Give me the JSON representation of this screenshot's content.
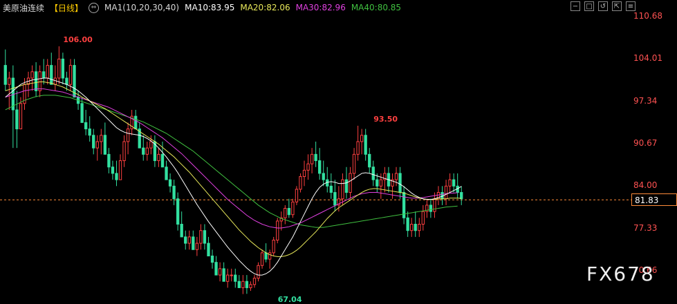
{
  "header": {
    "title": "美原油连续",
    "period": "【日线】",
    "settings_icon": "gear-icon",
    "switch_icon": "swap-icon",
    "ma_params": "MA1(10,20,30,40)",
    "ma10": "MA10:83.95",
    "ma20": "MA20:82.06",
    "ma30": "MA30:82.96",
    "ma40": "MA40:80.85"
  },
  "toolbar": {
    "buttons": [
      "−",
      "□",
      "↺",
      "⇱",
      "≡"
    ]
  },
  "watermark": "FX678",
  "colors": {
    "up": "#ff4040",
    "down": "#32e0a0",
    "ma10": "#ffffff",
    "ma20": "#e8e85a",
    "ma30": "#e040e0",
    "ma40": "#40c040",
    "axis_text": "#ff5252",
    "current_price_line": "#ff8c3a"
  },
  "chart_data": {
    "type": "candlestick",
    "y_ticks": [
      "110.68",
      "104.01",
      "97.34",
      "90.67",
      "84.00",
      "77.33",
      "70.66"
    ],
    "ylim": [
      67.04,
      110.68
    ],
    "current_price": "81.83",
    "annotations": [
      {
        "label": "106.00",
        "value": 106.0,
        "index": 14
      },
      {
        "label": "93.50",
        "value": 93.5,
        "index": 95
      },
      {
        "label": "67.04",
        "value": 67.04,
        "index": 70
      }
    ],
    "candles": [
      [
        103,
        105.5,
        99,
        100
      ],
      [
        100,
        102,
        96,
        101
      ],
      [
        101,
        103,
        90,
        96
      ],
      [
        96,
        99,
        90,
        93
      ],
      [
        93,
        98,
        93,
        97
      ],
      [
        97,
        101,
        96,
        100
      ],
      [
        100,
        102,
        98,
        101
      ],
      [
        101,
        103,
        99,
        102
      ],
      [
        102,
        103.5,
        98,
        99
      ],
      [
        99,
        103,
        98,
        102
      ],
      [
        102,
        104,
        100,
        101
      ],
      [
        101,
        104,
        100,
        103
      ],
      [
        103,
        105,
        100,
        100
      ],
      [
        100,
        103,
        99,
        101
      ],
      [
        101,
        106,
        100,
        104
      ],
      [
        104,
        105,
        100,
        101
      ],
      [
        101,
        102,
        99,
        100
      ],
      [
        100,
        104,
        99,
        103
      ],
      [
        103,
        104,
        98,
        98
      ],
      [
        98,
        99,
        96,
        97
      ],
      [
        97,
        98,
        94,
        94
      ],
      [
        94,
        96,
        92,
        93
      ],
      [
        93,
        95,
        91,
        92
      ],
      [
        92,
        93,
        89,
        90
      ],
      [
        90,
        92,
        88,
        91
      ],
      [
        91,
        93,
        89,
        92
      ],
      [
        92,
        94,
        89,
        89
      ],
      [
        89,
        90,
        86,
        87
      ],
      [
        87,
        88,
        85,
        86
      ],
      [
        86,
        88,
        84,
        85
      ],
      [
        85,
        89,
        85,
        88
      ],
      [
        88,
        92,
        87,
        91
      ],
      [
        91,
        94,
        89,
        93
      ],
      [
        93,
        96,
        92,
        95
      ],
      [
        95,
        96,
        93,
        93
      ],
      [
        93,
        94,
        90,
        90
      ],
      [
        90,
        92,
        88,
        89
      ],
      [
        89,
        91,
        88,
        90
      ],
      [
        90,
        92,
        89,
        91
      ],
      [
        91,
        92,
        87,
        88
      ],
      [
        88,
        90,
        87,
        89
      ],
      [
        89,
        91,
        87,
        87
      ],
      [
        87,
        88,
        85,
        85
      ],
      [
        85,
        86,
        83,
        84
      ],
      [
        84,
        85,
        81,
        82
      ],
      [
        82,
        83,
        77,
        78
      ],
      [
        78,
        80,
        76,
        76
      ],
      [
        76,
        77,
        74,
        75
      ],
      [
        75,
        77,
        74,
        76
      ],
      [
        76,
        77,
        74,
        74
      ],
      [
        74,
        76,
        73,
        75
      ],
      [
        75,
        78,
        74,
        77
      ],
      [
        77,
        78,
        74,
        75
      ],
      [
        75,
        76,
        73,
        73
      ],
      [
        73,
        74,
        71,
        72
      ],
      [
        72,
        73,
        70,
        70
      ],
      [
        70,
        72,
        69,
        71
      ],
      [
        71,
        72,
        69,
        69
      ],
      [
        69,
        71,
        68,
        70
      ],
      [
        70,
        71,
        69,
        70
      ],
      [
        70,
        71,
        68,
        69
      ],
      [
        69,
        70,
        68,
        68
      ],
      [
        68,
        70,
        67,
        69
      ],
      [
        69,
        70,
        67.04,
        68
      ],
      [
        68,
        69,
        67.5,
        68.5
      ],
      [
        68.5,
        70,
        68,
        69.5
      ],
      [
        69.5,
        72,
        69,
        71.5
      ],
      [
        71.5,
        74,
        71,
        73.5
      ],
      [
        73.5,
        75,
        72,
        72.5
      ],
      [
        72.5,
        74,
        71,
        73.5
      ],
      [
        73.5,
        76,
        73,
        75.5
      ],
      [
        75.5,
        79,
        75,
        78.5
      ],
      [
        78.5,
        80,
        77,
        79
      ],
      [
        79,
        81,
        78,
        80.5
      ],
      [
        80.5,
        82,
        79,
        79.5
      ],
      [
        79.5,
        82,
        79,
        81.5
      ],
      [
        81.5,
        84,
        81,
        83.5
      ],
      [
        83.5,
        86,
        83,
        85.5
      ],
      [
        85.5,
        88,
        84,
        86.5
      ],
      [
        86.5,
        89,
        85,
        87.5
      ],
      [
        87.5,
        90,
        86,
        89
      ],
      [
        89,
        91,
        87,
        88
      ],
      [
        88,
        90,
        85,
        86
      ],
      [
        86,
        88,
        84,
        85
      ],
      [
        85,
        87,
        83,
        84
      ],
      [
        84,
        86,
        82,
        83
      ],
      [
        83,
        85,
        80,
        81
      ],
      [
        81,
        84,
        80,
        82
      ],
      [
        82,
        86,
        81,
        85
      ],
      [
        85,
        87,
        82,
        83
      ],
      [
        83,
        87,
        82,
        86
      ],
      [
        86,
        90,
        85,
        89
      ],
      [
        89,
        93.5,
        88,
        91
      ],
      [
        91,
        93,
        89,
        92
      ],
      [
        92,
        93,
        88,
        89
      ],
      [
        89,
        90,
        86,
        87
      ],
      [
        87,
        88,
        84,
        85
      ],
      [
        85,
        86,
        83,
        84
      ],
      [
        84,
        86,
        82,
        85
      ],
      [
        85,
        87,
        83,
        86
      ],
      [
        86,
        87,
        83,
        84
      ],
      [
        84,
        86,
        82,
        85
      ],
      [
        85,
        87,
        84,
        86
      ],
      [
        86,
        87,
        82,
        83
      ],
      [
        83,
        84,
        78,
        79
      ],
      [
        79,
        80,
        76,
        77
      ],
      [
        77,
        79,
        76,
        78
      ],
      [
        78,
        80,
        76,
        77
      ],
      [
        77,
        79,
        76,
        78
      ],
      [
        78,
        81,
        77,
        80
      ],
      [
        80,
        82,
        79,
        81
      ],
      [
        81,
        82,
        79,
        80
      ],
      [
        80,
        83,
        79,
        82
      ],
      [
        82,
        84,
        81,
        83
      ],
      [
        83,
        84,
        81,
        82
      ],
      [
        82,
        85,
        81,
        84
      ],
      [
        84,
        86,
        83,
        85
      ],
      [
        85,
        86,
        83,
        84
      ],
      [
        84,
        86,
        82,
        83
      ],
      [
        83,
        84,
        81,
        82
      ]
    ],
    "ma10": [
      98,
      98.5,
      99,
      99.5,
      100,
      100.3,
      100.5,
      100.7,
      100.8,
      100.9,
      101,
      101,
      100.8,
      100.6,
      100.4,
      100.2,
      100,
      99.7,
      99.4,
      99,
      98.5,
      98,
      97.4,
      96.8,
      96.2,
      95.6,
      95,
      94.4,
      93.8,
      93.2,
      92.8,
      92.5,
      92.3,
      92.2,
      92.1,
      92,
      91.8,
      91.5,
      91.1,
      90.6,
      90,
      89.3,
      88.6,
      87.8,
      87,
      86.1,
      85.1,
      84.1,
      83.1,
      82.1,
      81.1,
      80.2,
      79.3,
      78.4,
      77.6,
      76.8,
      76,
      75.2,
      74.4,
      73.7,
      73,
      72.3,
      71.7,
      71.1,
      70.6,
      70.2,
      70,
      70,
      70.2,
      70.6,
      71.2,
      72,
      73,
      74,
      75,
      76,
      77.2,
      78.4,
      79.6,
      80.8,
      82,
      83,
      83.8,
      84.3,
      84.6,
      84.7,
      84.6,
      84.4,
      84.4,
      84.5,
      84.8,
      85.2,
      85.6,
      86,
      86.1,
      86,
      85.8,
      85.6,
      85.4,
      85.2,
      85,
      84.8,
      84.6,
      84.3,
      83.9,
      83.4,
      82.9,
      82.5,
      82.2,
      82,
      81.9,
      81.9,
      82,
      82.2,
      82.4,
      82.7,
      83,
      83.3,
      83.6,
      83.95
    ],
    "ma20": [
      99,
      99.2,
      99.4,
      99.6,
      99.8,
      100,
      100.1,
      100.2,
      100.3,
      100.4,
      100.4,
      100.3,
      100.2,
      100,
      99.8,
      99.6,
      99.3,
      99,
      98.7,
      98.4,
      98,
      97.7,
      97.4,
      97.1,
      96.8,
      96.5,
      96.2,
      95.8,
      95.4,
      95,
      94.6,
      94.2,
      93.8,
      93.4,
      93,
      92.6,
      92.2,
      91.8,
      91.4,
      91,
      90.6,
      90.1,
      89.6,
      89.1,
      88.6,
      88,
      87.4,
      86.8,
      86.2,
      85.5,
      84.8,
      84.1,
      83.4,
      82.7,
      82,
      81.3,
      80.6,
      79.9,
      79.2,
      78.5,
      77.8,
      77.1,
      76.5,
      75.9,
      75.3,
      74.8,
      74.3,
      73.9,
      73.5,
      73.2,
      73,
      72.9,
      72.9,
      73,
      73.2,
      73.5,
      73.9,
      74.4,
      75,
      75.6,
      76.2,
      76.8,
      77.5,
      78.2,
      78.9,
      79.5,
      80.1,
      80.6,
      81,
      81.4,
      81.8,
      82.2,
      82.6,
      83,
      83.3,
      83.5,
      83.6,
      83.6,
      83.5,
      83.4,
      83.3,
      83.2,
      83.1,
      83,
      82.9,
      82.7,
      82.5,
      82.3,
      82.1,
      82,
      81.9,
      81.9,
      81.9,
      82,
      82,
      82,
      82.1,
      82.1,
      82.1,
      82.06
    ],
    "ma30": [
      98,
      98.2,
      98.4,
      98.6,
      98.8,
      99,
      99.1,
      99.2,
      99.3,
      99.3,
      99.3,
      99.2,
      99.1,
      99,
      98.9,
      98.8,
      98.6,
      98.4,
      98.2,
      98,
      97.8,
      97.6,
      97.4,
      97.2,
      97,
      96.8,
      96.6,
      96.4,
      96.1,
      95.8,
      95.5,
      95.2,
      94.9,
      94.6,
      94.3,
      94,
      93.6,
      93.2,
      92.8,
      92.4,
      92,
      91.6,
      91.1,
      90.6,
      90.1,
      89.6,
      89.1,
      88.5,
      87.9,
      87.3,
      86.7,
      86.1,
      85.5,
      84.9,
      84.3,
      83.7,
      83.1,
      82.5,
      81.9,
      81.4,
      80.9,
      80.4,
      79.9,
      79.4,
      79,
      78.6,
      78.3,
      78,
      77.8,
      77.6,
      77.5,
      77.4,
      77.4,
      77.5,
      77.6,
      77.8,
      78,
      78.2,
      78.5,
      78.8,
      79.1,
      79.4,
      79.7,
      80,
      80.3,
      80.6,
      80.9,
      81.2,
      81.5,
      81.8,
      82.1,
      82.4,
      82.6,
      82.8,
      82.9,
      83,
      83,
      83,
      82.9,
      82.8,
      82.7,
      82.6,
      82.5,
      82.4,
      82.3,
      82.2,
      82.1,
      82.1,
      82.1,
      82.2,
      82.3,
      82.4,
      82.5,
      82.6,
      82.7,
      82.8,
      82.9,
      82.9,
      82.96
    ],
    "ma40": [
      96,
      96.3,
      96.6,
      96.9,
      97.2,
      97.5,
      97.7,
      97.9,
      98.1,
      98.2,
      98.3,
      98.3,
      98.3,
      98.3,
      98.2,
      98.1,
      98,
      97.9,
      97.7,
      97.5,
      97.3,
      97.1,
      96.9,
      96.7,
      96.5,
      96.3,
      96.1,
      95.9,
      95.7,
      95.5,
      95.3,
      95.1,
      94.9,
      94.7,
      94.5,
      94.3,
      94.1,
      93.8,
      93.5,
      93.2,
      92.9,
      92.6,
      92.3,
      91.9,
      91.5,
      91.1,
      90.7,
      90.3,
      89.9,
      89.5,
      89,
      88.5,
      88,
      87.5,
      87,
      86.5,
      86,
      85.5,
      85,
      84.5,
      84,
      83.5,
      83,
      82.5,
      82,
      81.5,
      81,
      80.6,
      80.2,
      79.8,
      79.5,
      79.2,
      78.9,
      78.7,
      78.5,
      78.3,
      78.1,
      77.9,
      77.8,
      77.7,
      77.6,
      77.5,
      77.5,
      77.5,
      77.6,
      77.7,
      77.8,
      77.9,
      78,
      78.1,
      78.2,
      78.3,
      78.4,
      78.5,
      78.6,
      78.7,
      78.8,
      78.9,
      79,
      79.1,
      79.2,
      79.3,
      79.4,
      79.5,
      79.6,
      79.7,
      79.8,
      79.9,
      80,
      80.1,
      80.2,
      80.3,
      80.4,
      80.5,
      80.6,
      80.7,
      80.75,
      80.8,
      80.85
    ]
  }
}
